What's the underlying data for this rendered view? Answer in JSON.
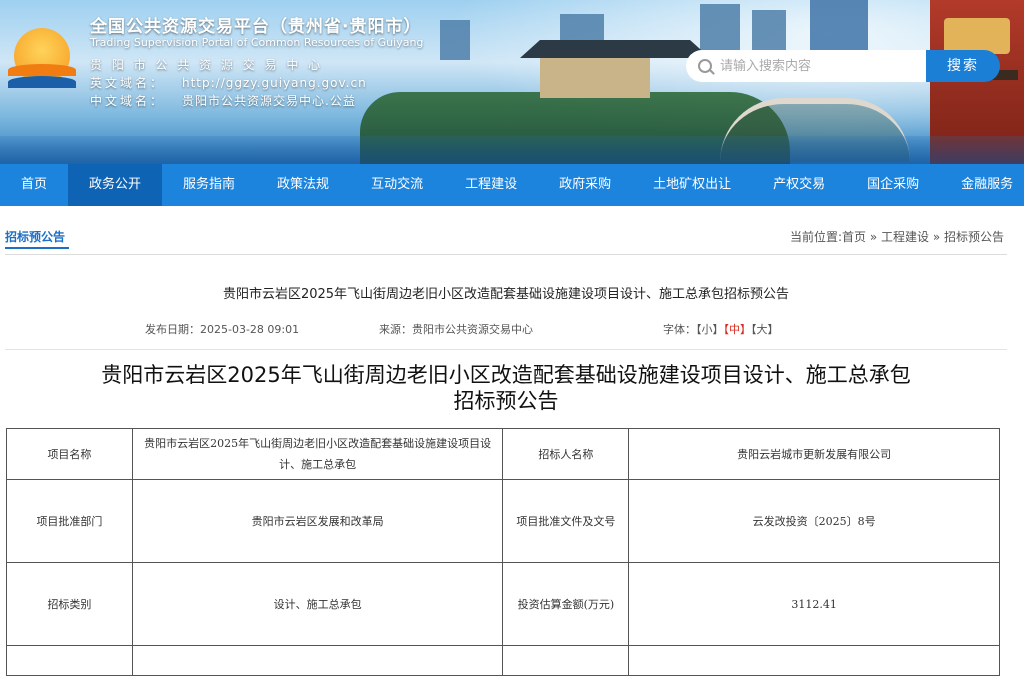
{
  "header": {
    "title": "全国公共资源交易平台（贵州省·贵阳市）",
    "subtitle_en": "Trading Supervision Portal of Common Resources of Guiyang",
    "org_name": "贵 阳 市 公 共 资 源 交 易 中 心",
    "en_domain_label": "英文域名：",
    "en_domain_value": "http://ggzy.guiyang.gov.cn",
    "cn_domain_label": "中文域名：",
    "cn_domain_value": "贵阳市公共资源交易中心.公益",
    "search": {
      "placeholder": "请输入搜索内容",
      "button_label": "搜索"
    }
  },
  "nav": {
    "items": [
      {
        "label": "首页"
      },
      {
        "label": "政务公开"
      },
      {
        "label": "服务指南"
      },
      {
        "label": "政策法规"
      },
      {
        "label": "互动交流"
      },
      {
        "label": "工程建设"
      },
      {
        "label": "政府采购"
      },
      {
        "label": "土地矿权出让"
      },
      {
        "label": "产权交易"
      },
      {
        "label": "国企采购"
      },
      {
        "label": "金融服务"
      }
    ],
    "active": "政务公开"
  },
  "breadcrumb": {
    "section_title": "招标预公告",
    "prefix": "当前位置:",
    "items": [
      "首页",
      "工程建设",
      "招标预公告"
    ],
    "separator": " » "
  },
  "article": {
    "title": "贵阳市云岩区2025年飞山街周边老旧小区改造配套基础设施建设项目设计、施工总承包招标预公告",
    "publish_date_label": "发布日期：",
    "publish_date": "2025-03-28 09:01",
    "source_label": "来源：",
    "source": "贵阳市公共资源交易中心",
    "font_label": "字体：",
    "font_sizes": [
      "【小】",
      "【中】",
      "【大】"
    ],
    "heading_line1": "贵阳市云岩区2025年飞山街周边老旧小区改造配套基础设施建设项目设计、施工总承包",
    "heading_line2": "招标预公告"
  },
  "table": {
    "rows": [
      {
        "label1": "项目名称",
        "value1": "贵阳市云岩区2025年飞山街周边老旧小区改造配套基础设施建设项目设计、施工总承包",
        "label2": "招标人名称",
        "value2": "贵阳云岩城市更新发展有限公司"
      },
      {
        "label1": "项目批准部门",
        "value1": "贵阳市云岩区发展和改革局",
        "label2": "项目批准文件及文号",
        "value2": "云发改投资〔2025〕8号"
      },
      {
        "label1": "招标类别",
        "value1": "设计、施工总承包",
        "label2": "投资估算金额(万元)",
        "value2": "3112.41"
      }
    ]
  }
}
